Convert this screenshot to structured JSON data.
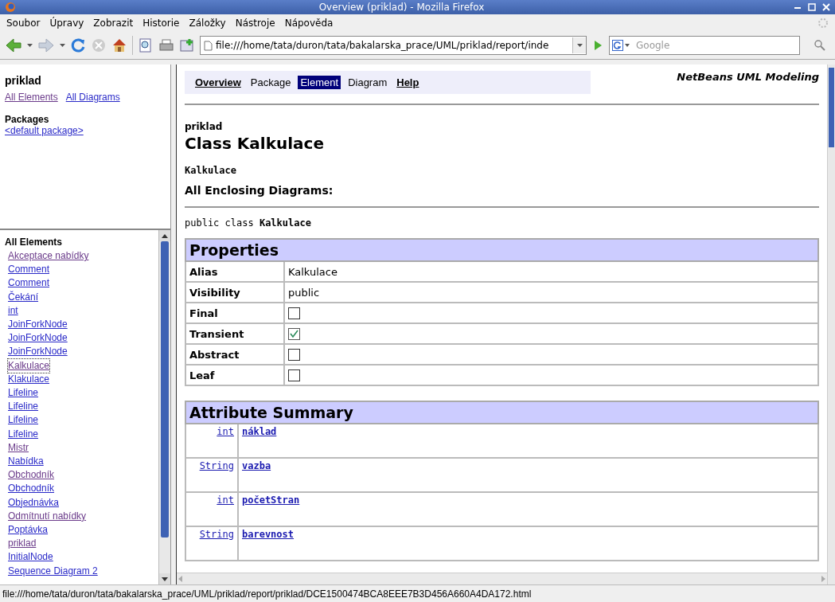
{
  "window": {
    "title": "Overview (priklad) - Mozilla Firefox"
  },
  "menu": [
    "Soubor",
    "Úpravy",
    "Zobrazit",
    "Historie",
    "Záložky",
    "Nástroje",
    "Nápověda"
  ],
  "toolbar": {
    "url": "file:///home/tata/duron/tata/bakalarska_prace/UML/priklad/report/inde",
    "search_placeholder": "Google"
  },
  "sidebar": {
    "title": "priklad",
    "links": [
      {
        "label": "All Elements",
        "visited": true
      },
      {
        "label": "All Diagrams",
        "visited": false
      }
    ],
    "packages_heading": "Packages",
    "packages": [
      {
        "label": "<default package>",
        "visited": false
      }
    ],
    "elements_heading": "All Elements",
    "elements": [
      {
        "label": "Akceptace nabídky",
        "visited": true
      },
      {
        "label": "Comment",
        "visited": false
      },
      {
        "label": "Comment",
        "visited": false
      },
      {
        "label": "Čekání",
        "visited": false
      },
      {
        "label": "int",
        "visited": false
      },
      {
        "label": "JoinForkNode",
        "visited": false
      },
      {
        "label": "JoinForkNode",
        "visited": false
      },
      {
        "label": "JoinForkNode",
        "visited": false
      },
      {
        "label": "Kalkulace",
        "visited": true,
        "focused": true
      },
      {
        "label": "Klakulace",
        "visited": false
      },
      {
        "label": "Lifeline",
        "visited": false
      },
      {
        "label": "Lifeline",
        "visited": false
      },
      {
        "label": "Lifeline",
        "visited": false
      },
      {
        "label": "Lifeline",
        "visited": false
      },
      {
        "label": "Mistr",
        "visited": true
      },
      {
        "label": "Nabídka",
        "visited": false
      },
      {
        "label": "Obchodník",
        "visited": true
      },
      {
        "label": "Obchodník",
        "visited": false
      },
      {
        "label": "Objednávka",
        "visited": false
      },
      {
        "label": "Odmítnutí nabídky",
        "visited": true
      },
      {
        "label": "Poptávka",
        "visited": false
      },
      {
        "label": "priklad",
        "visited": true
      },
      {
        "label": "InitialNode",
        "visited": false
      },
      {
        "label": "Sequence Diagram 2",
        "visited": false
      }
    ]
  },
  "nav": [
    {
      "label": "Overview",
      "kind": "link",
      "selected": false
    },
    {
      "label": "Package",
      "kind": "plain",
      "selected": false
    },
    {
      "label": "Element",
      "kind": "plain",
      "selected": true
    },
    {
      "label": "Diagram",
      "kind": "plain",
      "selected": false
    },
    {
      "label": "Help",
      "kind": "link",
      "selected": false
    }
  ],
  "brand": "NetBeans UML Modeling",
  "package_name": "priklad",
  "class_title": "Class Kalkulace",
  "class_name": "Kalkulace",
  "enclosing_heading": "All Enclosing Diagrams:",
  "declaration": {
    "prefix": "public class ",
    "name": "Kalkulace"
  },
  "properties": {
    "title": "Properties",
    "rows": [
      {
        "name": "Alias",
        "kind": "text",
        "value": "Kalkulace"
      },
      {
        "name": "Visibility",
        "kind": "text",
        "value": "public"
      },
      {
        "name": "Final",
        "kind": "checkbox",
        "checked": false
      },
      {
        "name": "Transient",
        "kind": "checkbox",
        "checked": true
      },
      {
        "name": "Abstract",
        "kind": "checkbox",
        "checked": false
      },
      {
        "name": "Leaf",
        "kind": "checkbox",
        "checked": false
      }
    ]
  },
  "attributes": {
    "title": "Attribute Summary",
    "rows": [
      {
        "type": "int",
        "name": "náklad"
      },
      {
        "type": "String",
        "name": "vazba"
      },
      {
        "type": "int",
        "name": "početStran"
      },
      {
        "type": "String",
        "name": "barevnost"
      }
    ]
  },
  "status_bar": "file:///home/tata/duron/tata/bakalarska_prace/UML/priklad/report/priklad/DCE1500474BCA8EEE7B3D456A660A4DA172.html"
}
